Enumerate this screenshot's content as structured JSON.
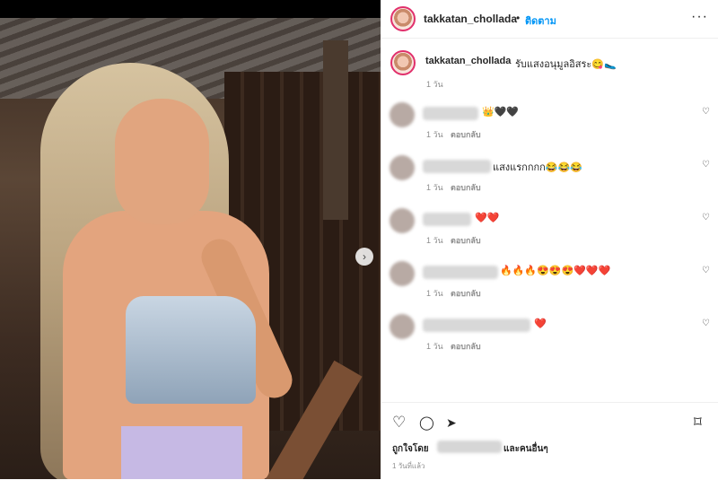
{
  "post": {
    "username": "takkatan_chollada",
    "follow_separator": "•",
    "follow_label": "ติดตาม",
    "more_label": "···",
    "caption_text": "รับแสงอนุมูลอิสระ😋🥿",
    "caption_time": "1 วัน",
    "next_label": "›"
  },
  "comments": [
    {
      "text": "👑🖤🖤",
      "time": "1 วัน",
      "reply": "ตอบกลับ"
    },
    {
      "text": "แสงแรกกกก😂😂😂",
      "time": "1 วัน",
      "reply": "ตอบกลับ"
    },
    {
      "text": "❤️❤️",
      "time": "1 วัน",
      "reply": "ตอบกลับ"
    },
    {
      "text": "🔥🔥🔥😍😍😍❤️❤️❤️",
      "time": "1 วัน",
      "reply": "ตอบกลับ"
    },
    {
      "text": "❤️",
      "time": "1 วัน",
      "reply": "ตอบกลับ"
    }
  ],
  "comment_like_icon": "♡",
  "actions": {
    "like_icon": "♡",
    "comment_icon": "◯",
    "share_icon": "➤",
    "save_icon": "⌑",
    "liked_by_prefix": "ถูกใจโดย",
    "liked_by_suffix": "และคนอื่นๆ",
    "post_time": "1 วันที่แล้ว"
  }
}
